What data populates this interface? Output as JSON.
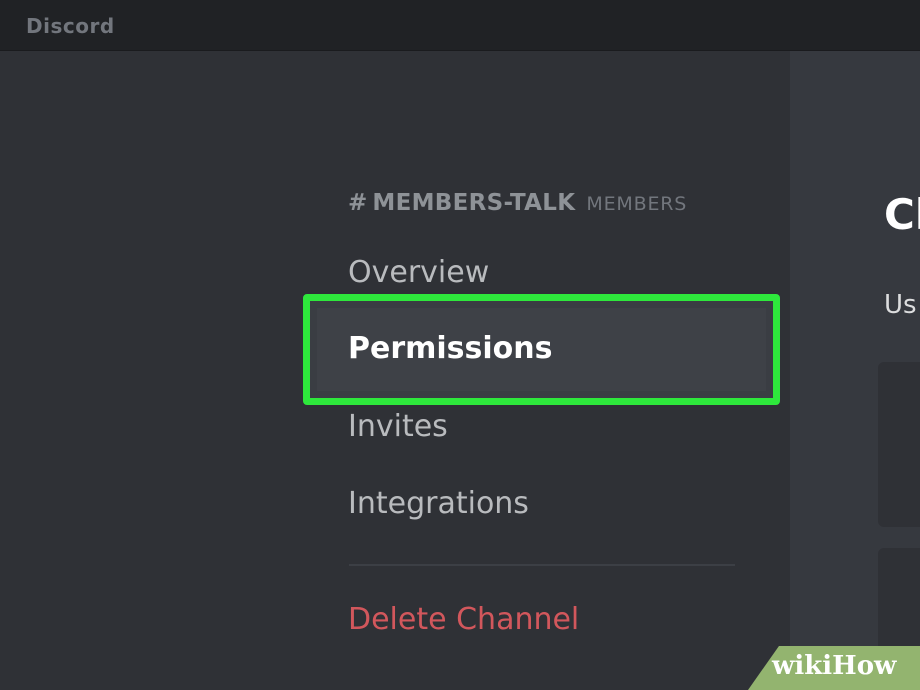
{
  "app": {
    "title": "Discord"
  },
  "channel": {
    "hash": "#",
    "name": "MEMBERS-TALK",
    "category": "MEMBERS"
  },
  "menu": {
    "items": [
      {
        "label": "Overview",
        "selected": false
      },
      {
        "label": "Permissions",
        "selected": true
      },
      {
        "label": "Invites",
        "selected": false
      },
      {
        "label": "Integrations",
        "selected": false
      }
    ],
    "delete_label": "Delete Channel"
  },
  "content": {
    "title_partial": "Cl",
    "subtitle_partial": "Us"
  },
  "watermark": {
    "text": "wikiHow"
  },
  "colors": {
    "highlight_border": "#2ee83c",
    "delete_text": "#d2575c",
    "sidebar_bg": "#2f3136",
    "content_bg": "#36393f"
  }
}
